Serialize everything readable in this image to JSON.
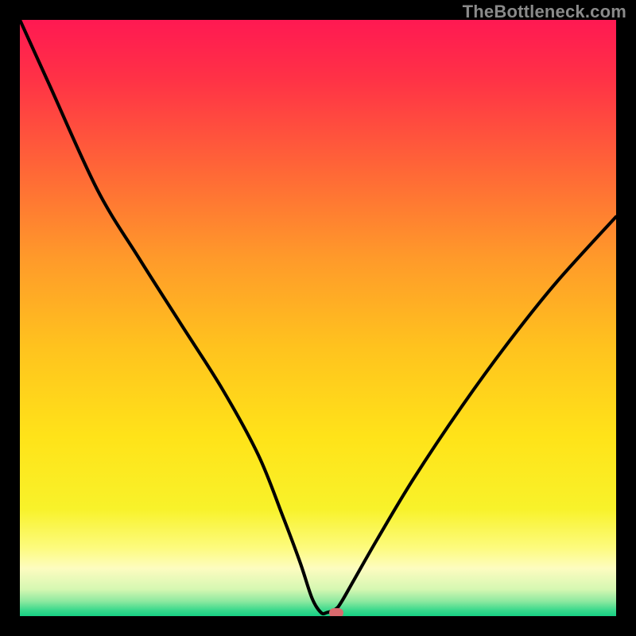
{
  "watermark": "TheBottleneck.com",
  "colors": {
    "frame_bg": "#000000",
    "marker": "#d96a6e",
    "curve": "#000000",
    "gradient_stops": [
      {
        "offset": 0.0,
        "color": "#ff1952"
      },
      {
        "offset": 0.1,
        "color": "#ff3246"
      },
      {
        "offset": 0.25,
        "color": "#ff6637"
      },
      {
        "offset": 0.4,
        "color": "#ff9a2a"
      },
      {
        "offset": 0.55,
        "color": "#ffc31e"
      },
      {
        "offset": 0.7,
        "color": "#ffe319"
      },
      {
        "offset": 0.82,
        "color": "#f8f22a"
      },
      {
        "offset": 0.885,
        "color": "#fdfb7d"
      },
      {
        "offset": 0.92,
        "color": "#fdfcc0"
      },
      {
        "offset": 0.955,
        "color": "#d5f7b2"
      },
      {
        "offset": 0.975,
        "color": "#8ee9a0"
      },
      {
        "offset": 0.99,
        "color": "#3ad98c"
      },
      {
        "offset": 1.0,
        "color": "#17cf84"
      }
    ]
  },
  "chart_data": {
    "type": "line",
    "title": "",
    "xlabel": "",
    "ylabel": "",
    "xlim": [
      0,
      100
    ],
    "ylim": [
      0,
      100
    ],
    "x": [
      0,
      5,
      13,
      20,
      27,
      34,
      40,
      44,
      47,
      49,
      50.5,
      51.5,
      53,
      54,
      56,
      60,
      66,
      74,
      82,
      90,
      100
    ],
    "values": [
      100,
      89,
      71.5,
      60,
      49,
      38,
      27,
      17,
      9,
      3,
      0.6,
      0.6,
      1.2,
      2.5,
      6,
      13,
      23,
      35,
      46,
      56,
      67
    ],
    "marker": {
      "x": 53,
      "y": 0.6
    }
  }
}
